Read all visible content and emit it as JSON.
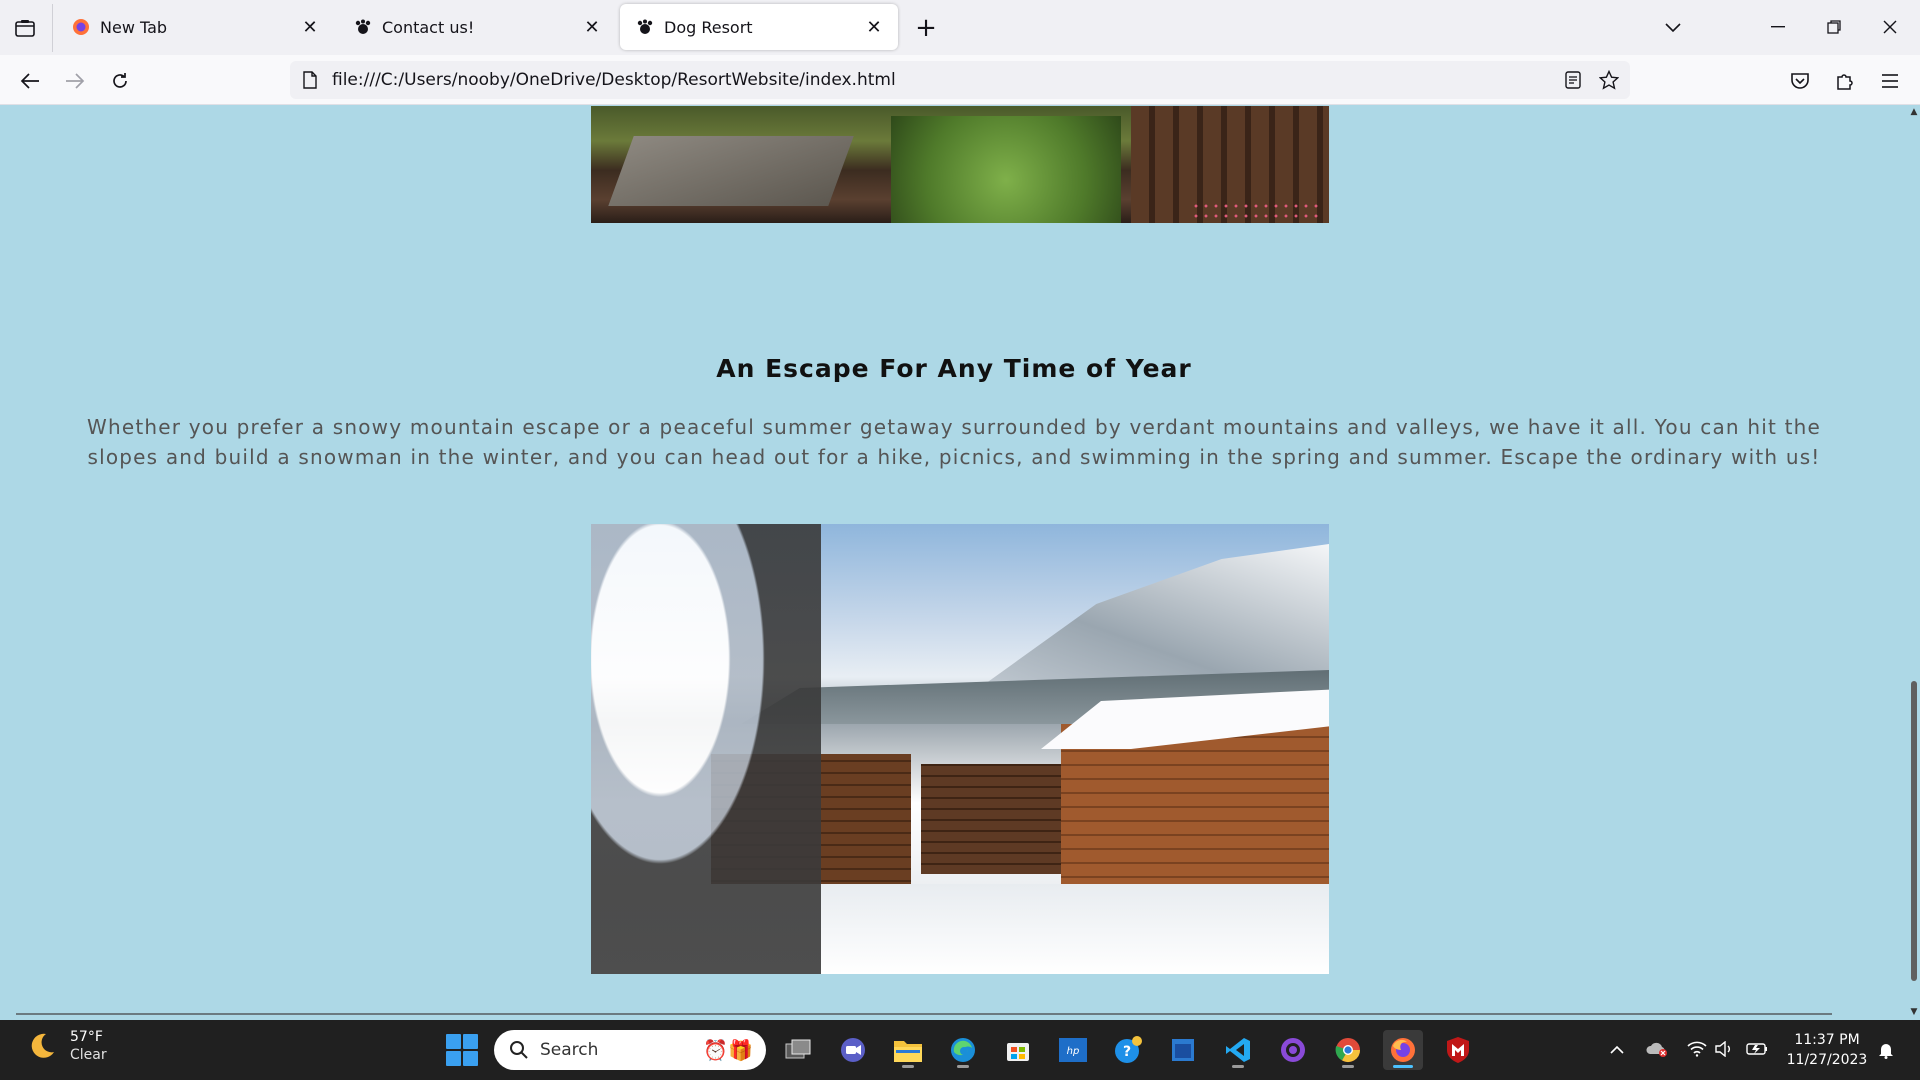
{
  "browser": {
    "tabs": [
      {
        "title": "New Tab",
        "favicon": "firefox-icon",
        "active": false
      },
      {
        "title": "Contact us!",
        "favicon": "dog-paw-icon",
        "active": false
      },
      {
        "title": "Dog Resort",
        "favicon": "dog-paw-icon",
        "active": true
      }
    ],
    "tab_close_glyph": "✕",
    "new_tab_glyph": "+",
    "url": "file:///C:/Users/nooby/OneDrive/Desktop/ResortWebsite/index.html"
  },
  "page": {
    "section_title": "An Escape For Any Time of Year",
    "section_text": "Whether you prefer a snowy mountain escape or a peaceful summer getaway surrounded by verdant mountains and valleys, we have it all. You can hit the slopes and build a snowman in the winter, and you can head out for a hike, picnics, and swimming in the spring and summer. Escape the ordinary with us!",
    "images": [
      "village-summer-photo",
      "village-winter-photo"
    ]
  },
  "taskbar": {
    "weather": {
      "temp": "57°F",
      "condition": "Clear"
    },
    "search_label": "Search",
    "clock": {
      "time": "11:37 PM",
      "date": "11/27/2023"
    },
    "colors": {
      "accent": "#4cc2ff",
      "background": "#202020"
    }
  },
  "colors": {
    "page_background": "#add8e6",
    "title": "#111111",
    "body_text": "#555555"
  }
}
